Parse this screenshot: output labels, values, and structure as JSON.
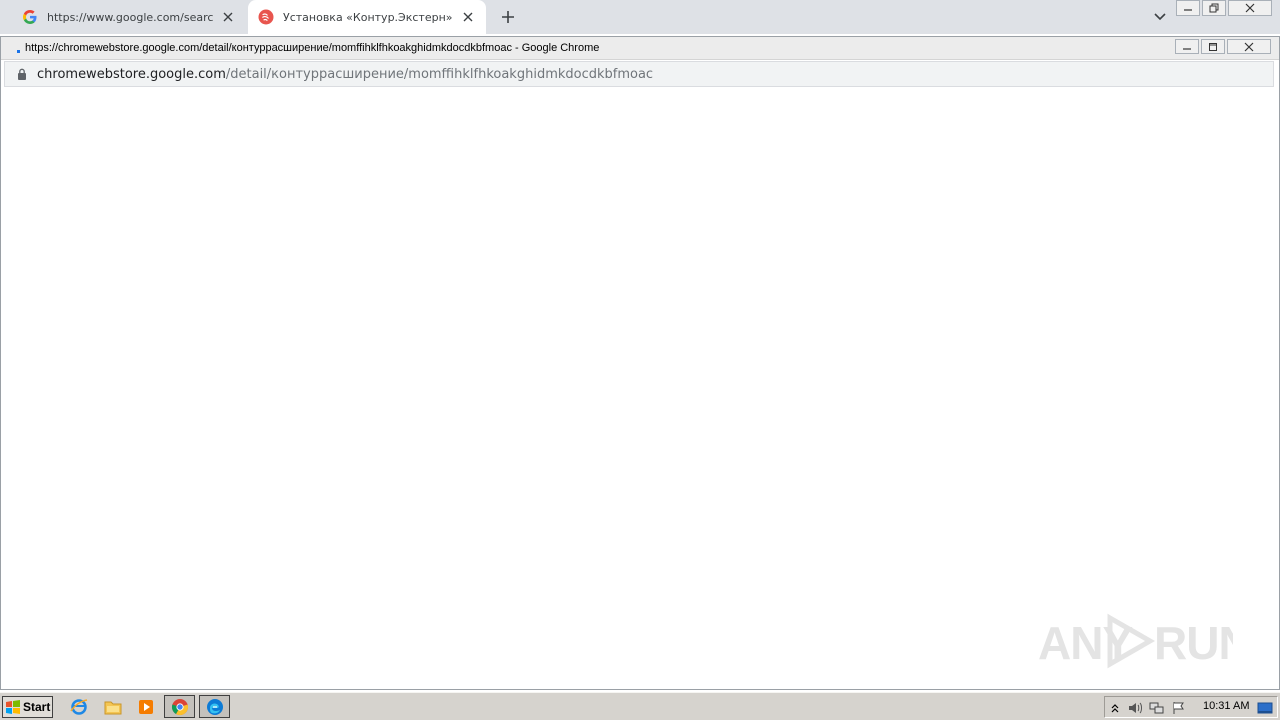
{
  "tabs": [
    {
      "title": "https://www.google.com/search?q=",
      "favicon": "google-g-icon",
      "active": false
    },
    {
      "title": "Установка «Контур.Экстерн»",
      "favicon": "kontur-icon",
      "active": true
    }
  ],
  "popup_window": {
    "title": "https://chromewebstore.google.com/detail/контуррасширение/momffihklfhkoakghidmkdocdkbfmoac - Google Chrome",
    "address": {
      "host": "chromewebstore.google.com",
      "path": "/detail/контуррасширение/momffihklfhkoakghidmkdocdkbfmoac"
    }
  },
  "watermark": {
    "text": "ANY RUN"
  },
  "taskbar": {
    "start_label": "Start",
    "quick_launch": [
      "ie-icon",
      "explorer-folder-icon",
      "media-player-icon"
    ],
    "tasks": [
      "chrome-icon",
      "edge-icon"
    ],
    "tray_icons": [
      "show-hidden-icons-icon",
      "volume-icon",
      "network-icon",
      "action-center-flag-icon",
      "show-desktop-icon"
    ],
    "clock": "10:31 AM"
  },
  "colors": {
    "tabstrip": "#dee1e6",
    "omnibox": "#f1f3f4",
    "taskbar": "#d6d3ce",
    "link_blue": "#1a73e8"
  }
}
